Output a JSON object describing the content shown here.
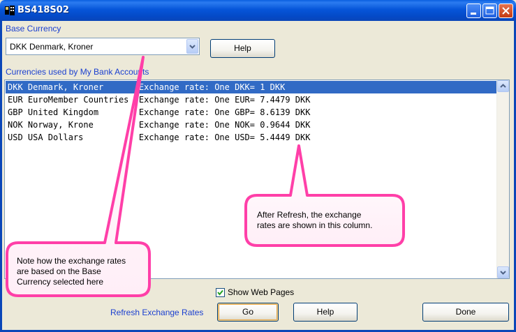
{
  "window": {
    "title": "BS418S02"
  },
  "icons": {
    "app": "app-icon",
    "minimize": "minimize-icon",
    "maximize": "maximize-icon",
    "close": "close-icon",
    "dropdown": "chevron-down-icon",
    "scroll_up": "scroll-up-icon",
    "scroll_down": "scroll-down-icon",
    "checkbox": "checkmark-icon"
  },
  "base_currency": {
    "label": "Base Currency",
    "selected": "DKK Denmark, Kroner"
  },
  "buttons": {
    "help_top": "Help",
    "go": "Go",
    "help_bottom": "Help",
    "done": "Done"
  },
  "currencies": {
    "label": "Currencies used by My Bank Accounts",
    "rows": [
      "DKK Denmark, Kroner       Exchange rate: One DKK= 1 DKK",
      "EUR EuroMember Countries  Exchange rate: One EUR= 7.4479 DKK",
      "GBP United Kingdom        Exchange rate: One GBP= 8.6139 DKK",
      "NOK Norway, Krone         Exchange rate: One NOK= 0.9644 DKK",
      "USD USA Dollars           Exchange rate: One USD= 5.4449 DKK"
    ],
    "selected_index": 0
  },
  "show_web_pages": {
    "label": "Show Web Pages",
    "checked": true
  },
  "refresh": {
    "label": "Refresh Exchange Rates"
  },
  "callouts": {
    "right": [
      "After Refresh, the exchange",
      "rates are shown in this column."
    ],
    "left": [
      "Note how the exchange rates",
      "are based on the Base",
      "Currency selected here"
    ]
  },
  "colors": {
    "titlebar": "#0655d9",
    "label_blue": "#1a3fd0",
    "selection": "#316ac5",
    "callout_border": "#ff3fa8",
    "callout_fill": "#fff4fa"
  }
}
